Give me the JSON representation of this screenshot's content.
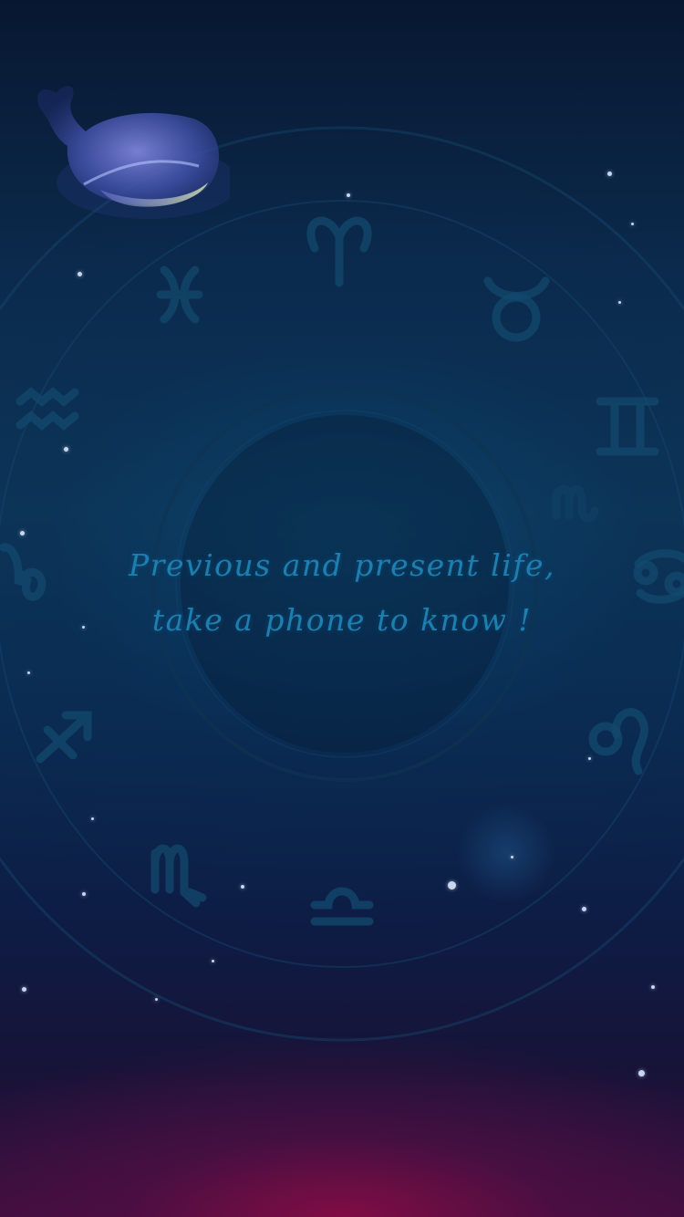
{
  "splash": {
    "tagline_line1": "Previous and present life,",
    "tagline_line2": "take a phone to know !"
  },
  "zodiac_icons": [
    "aries-icon",
    "taurus-icon",
    "gemini-icon",
    "cancer-icon",
    "leo-icon",
    "virgo-icon",
    "libra-icon",
    "scorpio-icon",
    "sagittarius-icon",
    "capricorn-icon",
    "aquarius-icon",
    "pisces-icon"
  ],
  "colors": {
    "tagline": "#1d7fb0",
    "background_top": "#081731",
    "background_mid": "#0d3658",
    "background_bottom_glow": "#8c0c46",
    "zodiac_symbol": "#134a6e"
  }
}
